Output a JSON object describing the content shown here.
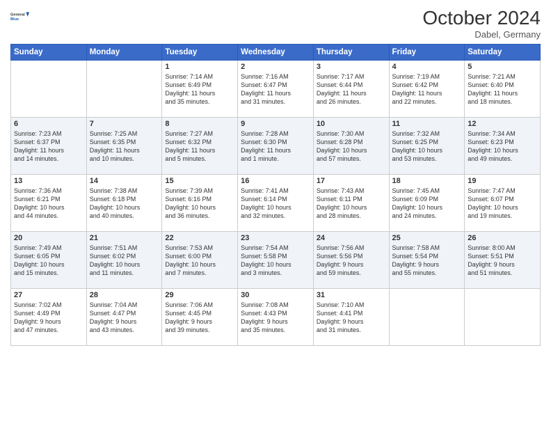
{
  "header": {
    "logo_line1": "General",
    "logo_line2": "Blue",
    "month": "October 2024",
    "location": "Dabel, Germany"
  },
  "weekdays": [
    "Sunday",
    "Monday",
    "Tuesday",
    "Wednesday",
    "Thursday",
    "Friday",
    "Saturday"
  ],
  "weeks": [
    [
      {
        "day": "",
        "text": ""
      },
      {
        "day": "",
        "text": ""
      },
      {
        "day": "1",
        "text": "Sunrise: 7:14 AM\nSunset: 6:49 PM\nDaylight: 11 hours\nand 35 minutes."
      },
      {
        "day": "2",
        "text": "Sunrise: 7:16 AM\nSunset: 6:47 PM\nDaylight: 11 hours\nand 31 minutes."
      },
      {
        "day": "3",
        "text": "Sunrise: 7:17 AM\nSunset: 6:44 PM\nDaylight: 11 hours\nand 26 minutes."
      },
      {
        "day": "4",
        "text": "Sunrise: 7:19 AM\nSunset: 6:42 PM\nDaylight: 11 hours\nand 22 minutes."
      },
      {
        "day": "5",
        "text": "Sunrise: 7:21 AM\nSunset: 6:40 PM\nDaylight: 11 hours\nand 18 minutes."
      }
    ],
    [
      {
        "day": "6",
        "text": "Sunrise: 7:23 AM\nSunset: 6:37 PM\nDaylight: 11 hours\nand 14 minutes."
      },
      {
        "day": "7",
        "text": "Sunrise: 7:25 AM\nSunset: 6:35 PM\nDaylight: 11 hours\nand 10 minutes."
      },
      {
        "day": "8",
        "text": "Sunrise: 7:27 AM\nSunset: 6:32 PM\nDaylight: 11 hours\nand 5 minutes."
      },
      {
        "day": "9",
        "text": "Sunrise: 7:28 AM\nSunset: 6:30 PM\nDaylight: 11 hours\nand 1 minute."
      },
      {
        "day": "10",
        "text": "Sunrise: 7:30 AM\nSunset: 6:28 PM\nDaylight: 10 hours\nand 57 minutes."
      },
      {
        "day": "11",
        "text": "Sunrise: 7:32 AM\nSunset: 6:25 PM\nDaylight: 10 hours\nand 53 minutes."
      },
      {
        "day": "12",
        "text": "Sunrise: 7:34 AM\nSunset: 6:23 PM\nDaylight: 10 hours\nand 49 minutes."
      }
    ],
    [
      {
        "day": "13",
        "text": "Sunrise: 7:36 AM\nSunset: 6:21 PM\nDaylight: 10 hours\nand 44 minutes."
      },
      {
        "day": "14",
        "text": "Sunrise: 7:38 AM\nSunset: 6:18 PM\nDaylight: 10 hours\nand 40 minutes."
      },
      {
        "day": "15",
        "text": "Sunrise: 7:39 AM\nSunset: 6:16 PM\nDaylight: 10 hours\nand 36 minutes."
      },
      {
        "day": "16",
        "text": "Sunrise: 7:41 AM\nSunset: 6:14 PM\nDaylight: 10 hours\nand 32 minutes."
      },
      {
        "day": "17",
        "text": "Sunrise: 7:43 AM\nSunset: 6:11 PM\nDaylight: 10 hours\nand 28 minutes."
      },
      {
        "day": "18",
        "text": "Sunrise: 7:45 AM\nSunset: 6:09 PM\nDaylight: 10 hours\nand 24 minutes."
      },
      {
        "day": "19",
        "text": "Sunrise: 7:47 AM\nSunset: 6:07 PM\nDaylight: 10 hours\nand 19 minutes."
      }
    ],
    [
      {
        "day": "20",
        "text": "Sunrise: 7:49 AM\nSunset: 6:05 PM\nDaylight: 10 hours\nand 15 minutes."
      },
      {
        "day": "21",
        "text": "Sunrise: 7:51 AM\nSunset: 6:02 PM\nDaylight: 10 hours\nand 11 minutes."
      },
      {
        "day": "22",
        "text": "Sunrise: 7:53 AM\nSunset: 6:00 PM\nDaylight: 10 hours\nand 7 minutes."
      },
      {
        "day": "23",
        "text": "Sunrise: 7:54 AM\nSunset: 5:58 PM\nDaylight: 10 hours\nand 3 minutes."
      },
      {
        "day": "24",
        "text": "Sunrise: 7:56 AM\nSunset: 5:56 PM\nDaylight: 9 hours\nand 59 minutes."
      },
      {
        "day": "25",
        "text": "Sunrise: 7:58 AM\nSunset: 5:54 PM\nDaylight: 9 hours\nand 55 minutes."
      },
      {
        "day": "26",
        "text": "Sunrise: 8:00 AM\nSunset: 5:51 PM\nDaylight: 9 hours\nand 51 minutes."
      }
    ],
    [
      {
        "day": "27",
        "text": "Sunrise: 7:02 AM\nSunset: 4:49 PM\nDaylight: 9 hours\nand 47 minutes."
      },
      {
        "day": "28",
        "text": "Sunrise: 7:04 AM\nSunset: 4:47 PM\nDaylight: 9 hours\nand 43 minutes."
      },
      {
        "day": "29",
        "text": "Sunrise: 7:06 AM\nSunset: 4:45 PM\nDaylight: 9 hours\nand 39 minutes."
      },
      {
        "day": "30",
        "text": "Sunrise: 7:08 AM\nSunset: 4:43 PM\nDaylight: 9 hours\nand 35 minutes."
      },
      {
        "day": "31",
        "text": "Sunrise: 7:10 AM\nSunset: 4:41 PM\nDaylight: 9 hours\nand 31 minutes."
      },
      {
        "day": "",
        "text": ""
      },
      {
        "day": "",
        "text": ""
      }
    ]
  ]
}
